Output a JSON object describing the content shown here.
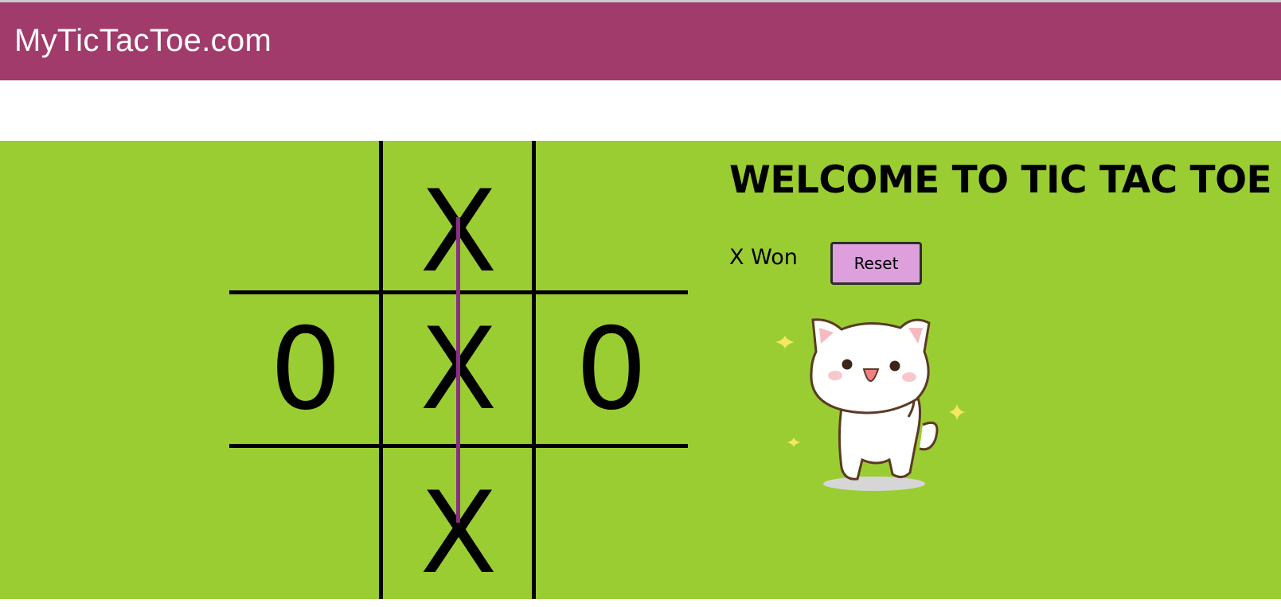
{
  "navbar": {
    "brand": "MyTicTacToe.com"
  },
  "board": {
    "cells": [
      [
        "",
        "X",
        ""
      ],
      [
        "0",
        "X",
        "0"
      ],
      [
        "",
        "X",
        ""
      ]
    ],
    "winning_line": "middle-column"
  },
  "side": {
    "title": "WELCOME TO TIC TAC TOE",
    "status": "X Won",
    "reset_label": "Reset",
    "image": "happy-cat-icon"
  },
  "colors": {
    "navbar": "#a13b6b",
    "background": "#9acd32",
    "win_line": "#8a2f85",
    "reset_button": "#dda0dd"
  }
}
